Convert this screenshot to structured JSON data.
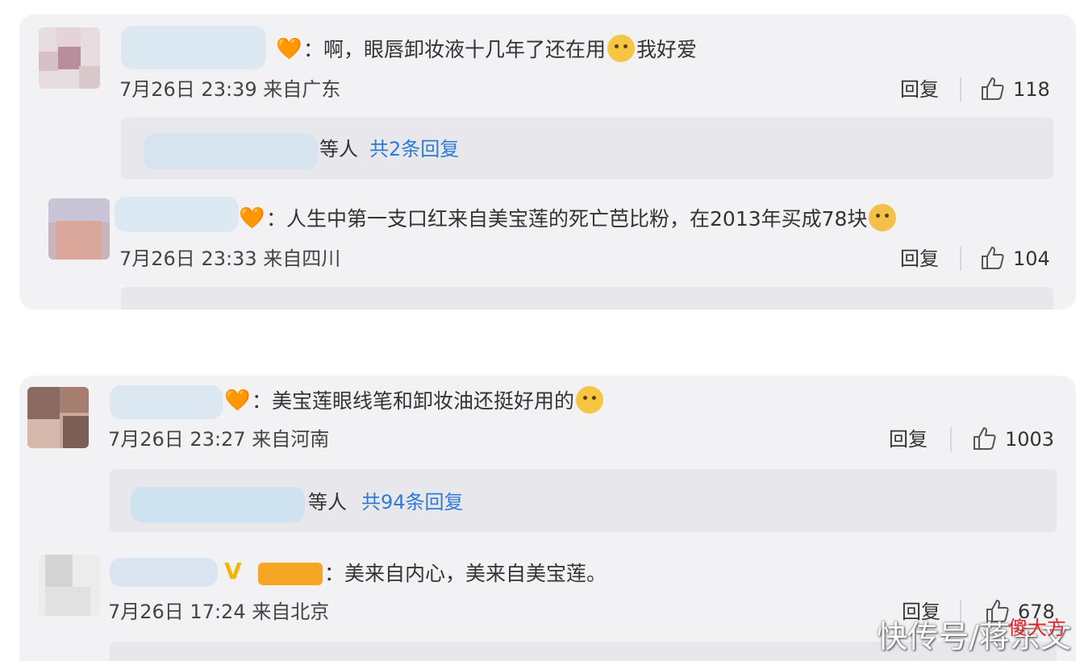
{
  "comments": [
    {
      "text": "：啊，眼唇卸妆液十几年了还在用",
      "text_after": "我好爱",
      "date": "7月26日 23:39 来自广东",
      "reply": "回复",
      "likes": "118",
      "sub": {
        "who": "等人",
        "more": "共2条回复"
      }
    },
    {
      "text": "：人生中第一支口红来自美宝莲的死亡芭比粉，在2013年买成78块",
      "text_after": "",
      "date": "7月26日 23:33 来自四川",
      "reply": "回复",
      "likes": "104"
    },
    {
      "text": "：美宝莲眼线笔和卸妆油还挺好用的",
      "text_after": "",
      "date": "7月26日 23:27 来自河南",
      "reply": "回复",
      "likes": "1003",
      "sub": {
        "who": "等人",
        "more": "共94条回复"
      }
    },
    {
      "text": "：美来自内心，美来自美宝莲。",
      "text_after": "",
      "date": "7月26日 17:24 来自北京",
      "reply": "回复",
      "likes": "678"
    }
  ],
  "watermark": {
    "main": "快传号/蒋东文",
    "badge": "傻大方"
  },
  "icons": {
    "like": "thumbs-up-icon",
    "vip": "v-verified-icon",
    "emoji": "smile-emoji-icon",
    "fan_badge": "fan-badge-icon"
  },
  "colors": {
    "panel": "#f2f2f4",
    "link": "#2e7bd6",
    "badge": "#f6a623"
  }
}
